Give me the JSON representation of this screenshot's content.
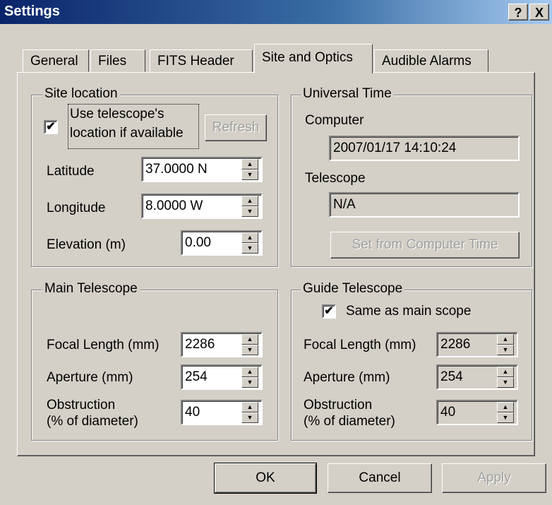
{
  "window": {
    "title": "Settings",
    "help_button": "?",
    "close_button": "X"
  },
  "tabs": [
    {
      "label": "General"
    },
    {
      "label": "Files"
    },
    {
      "label": "FITS Header"
    },
    {
      "label": "Site and Optics",
      "active": true
    },
    {
      "label": "Audible Alarms"
    }
  ],
  "site_location": {
    "group_label": "Site location",
    "use_scope_location_line1": "Use telescope's",
    "use_scope_location_line2": "location if available",
    "use_scope_location_checked": true,
    "refresh_button": "Refresh",
    "latitude_label": "Latitude",
    "latitude_value": "37.0000 N",
    "longitude_label": "Longitude",
    "longitude_value": "8.0000 W",
    "elevation_label": "Elevation (m)",
    "elevation_value": "0.00"
  },
  "universal_time": {
    "group_label": "Universal Time",
    "computer_label": "Computer",
    "computer_value": "2007/01/17 14:10:24",
    "telescope_label": "Telescope",
    "telescope_value": "N/A",
    "set_button": "Set from Computer Time"
  },
  "main_telescope": {
    "group_label": "Main Telescope",
    "focal_label": "Focal Length (mm)",
    "focal_value": "2286",
    "aperture_label": "Aperture (mm)",
    "aperture_value": "254",
    "obstruction_label_line1": "Obstruction",
    "obstruction_label_line2": "(% of diameter)",
    "obstruction_value": "40"
  },
  "guide_telescope": {
    "group_label": "Guide Telescope",
    "same_as_main_label": "Same as main scope",
    "same_as_main_checked": true,
    "focal_label": "Focal Length (mm)",
    "focal_value": "2286",
    "aperture_label": "Aperture (mm)",
    "aperture_value": "254",
    "obstruction_label_line1": "Obstruction",
    "obstruction_label_line2": "(% of diameter)",
    "obstruction_value": "40"
  },
  "footer": {
    "ok_button": "OK",
    "cancel_button": "Cancel",
    "apply_button": "Apply"
  },
  "icons": {
    "check_glyph": "✔",
    "spin_up_glyph": "▲",
    "spin_down_glyph": "▼"
  }
}
